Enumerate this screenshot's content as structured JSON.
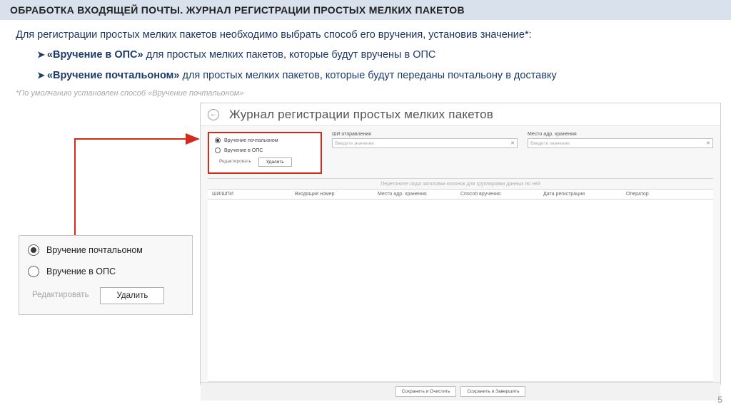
{
  "header": {
    "title": "ОБРАБОТКА ВХОДЯЩЕЙ ПОЧТЫ. ЖУРНАЛ РЕГИСТРАЦИИ ПРОСТЫХ МЕЛКИХ ПАКЕТОВ"
  },
  "body": {
    "intro": "Для регистрации простых мелких пакетов необходимо выбрать способ его вручения, установив значение*:",
    "b1_bold": "«Вручение в ОПС»",
    "b1_rest": " для простых мелких пакетов, которые будут вручены в ОПС",
    "b2_bold": "«Вручение почтальоном»",
    "b2_rest": " для простых мелких пакетов, которые будут переданы почтальону в доставку",
    "footnote": "*По умолчанию установлен способ «Вручение почтальоном»"
  },
  "app": {
    "title": "Журнал регистрации простых мелких пакетов",
    "radio1": "Вручение почтальоном",
    "radio2": "Вручение в ОПС",
    "edit": "Редактировать",
    "delete": "Удалить",
    "field1_label": "ШИ отправления",
    "field1_ph": "Введите значение",
    "field2_label": "Место адр. хранения",
    "field2_ph": "Введите значение",
    "hint": "Перетяните сюда заголовки колонок для группировки данных по ней",
    "cols": [
      "ШИ/ШПИ",
      "Входящий номер",
      "Место адр. хранения",
      "Способ вручения",
      "Дата регистрации",
      "Оператор"
    ],
    "btn1": "Сохранить и Очистить",
    "btn2": "Сохранить и Завершить"
  },
  "callout": {
    "radio1": "Вручение почтальоном",
    "radio2": "Вручение в ОПС",
    "edit": "Редактировать",
    "delete": "Удалить"
  },
  "page": "5"
}
